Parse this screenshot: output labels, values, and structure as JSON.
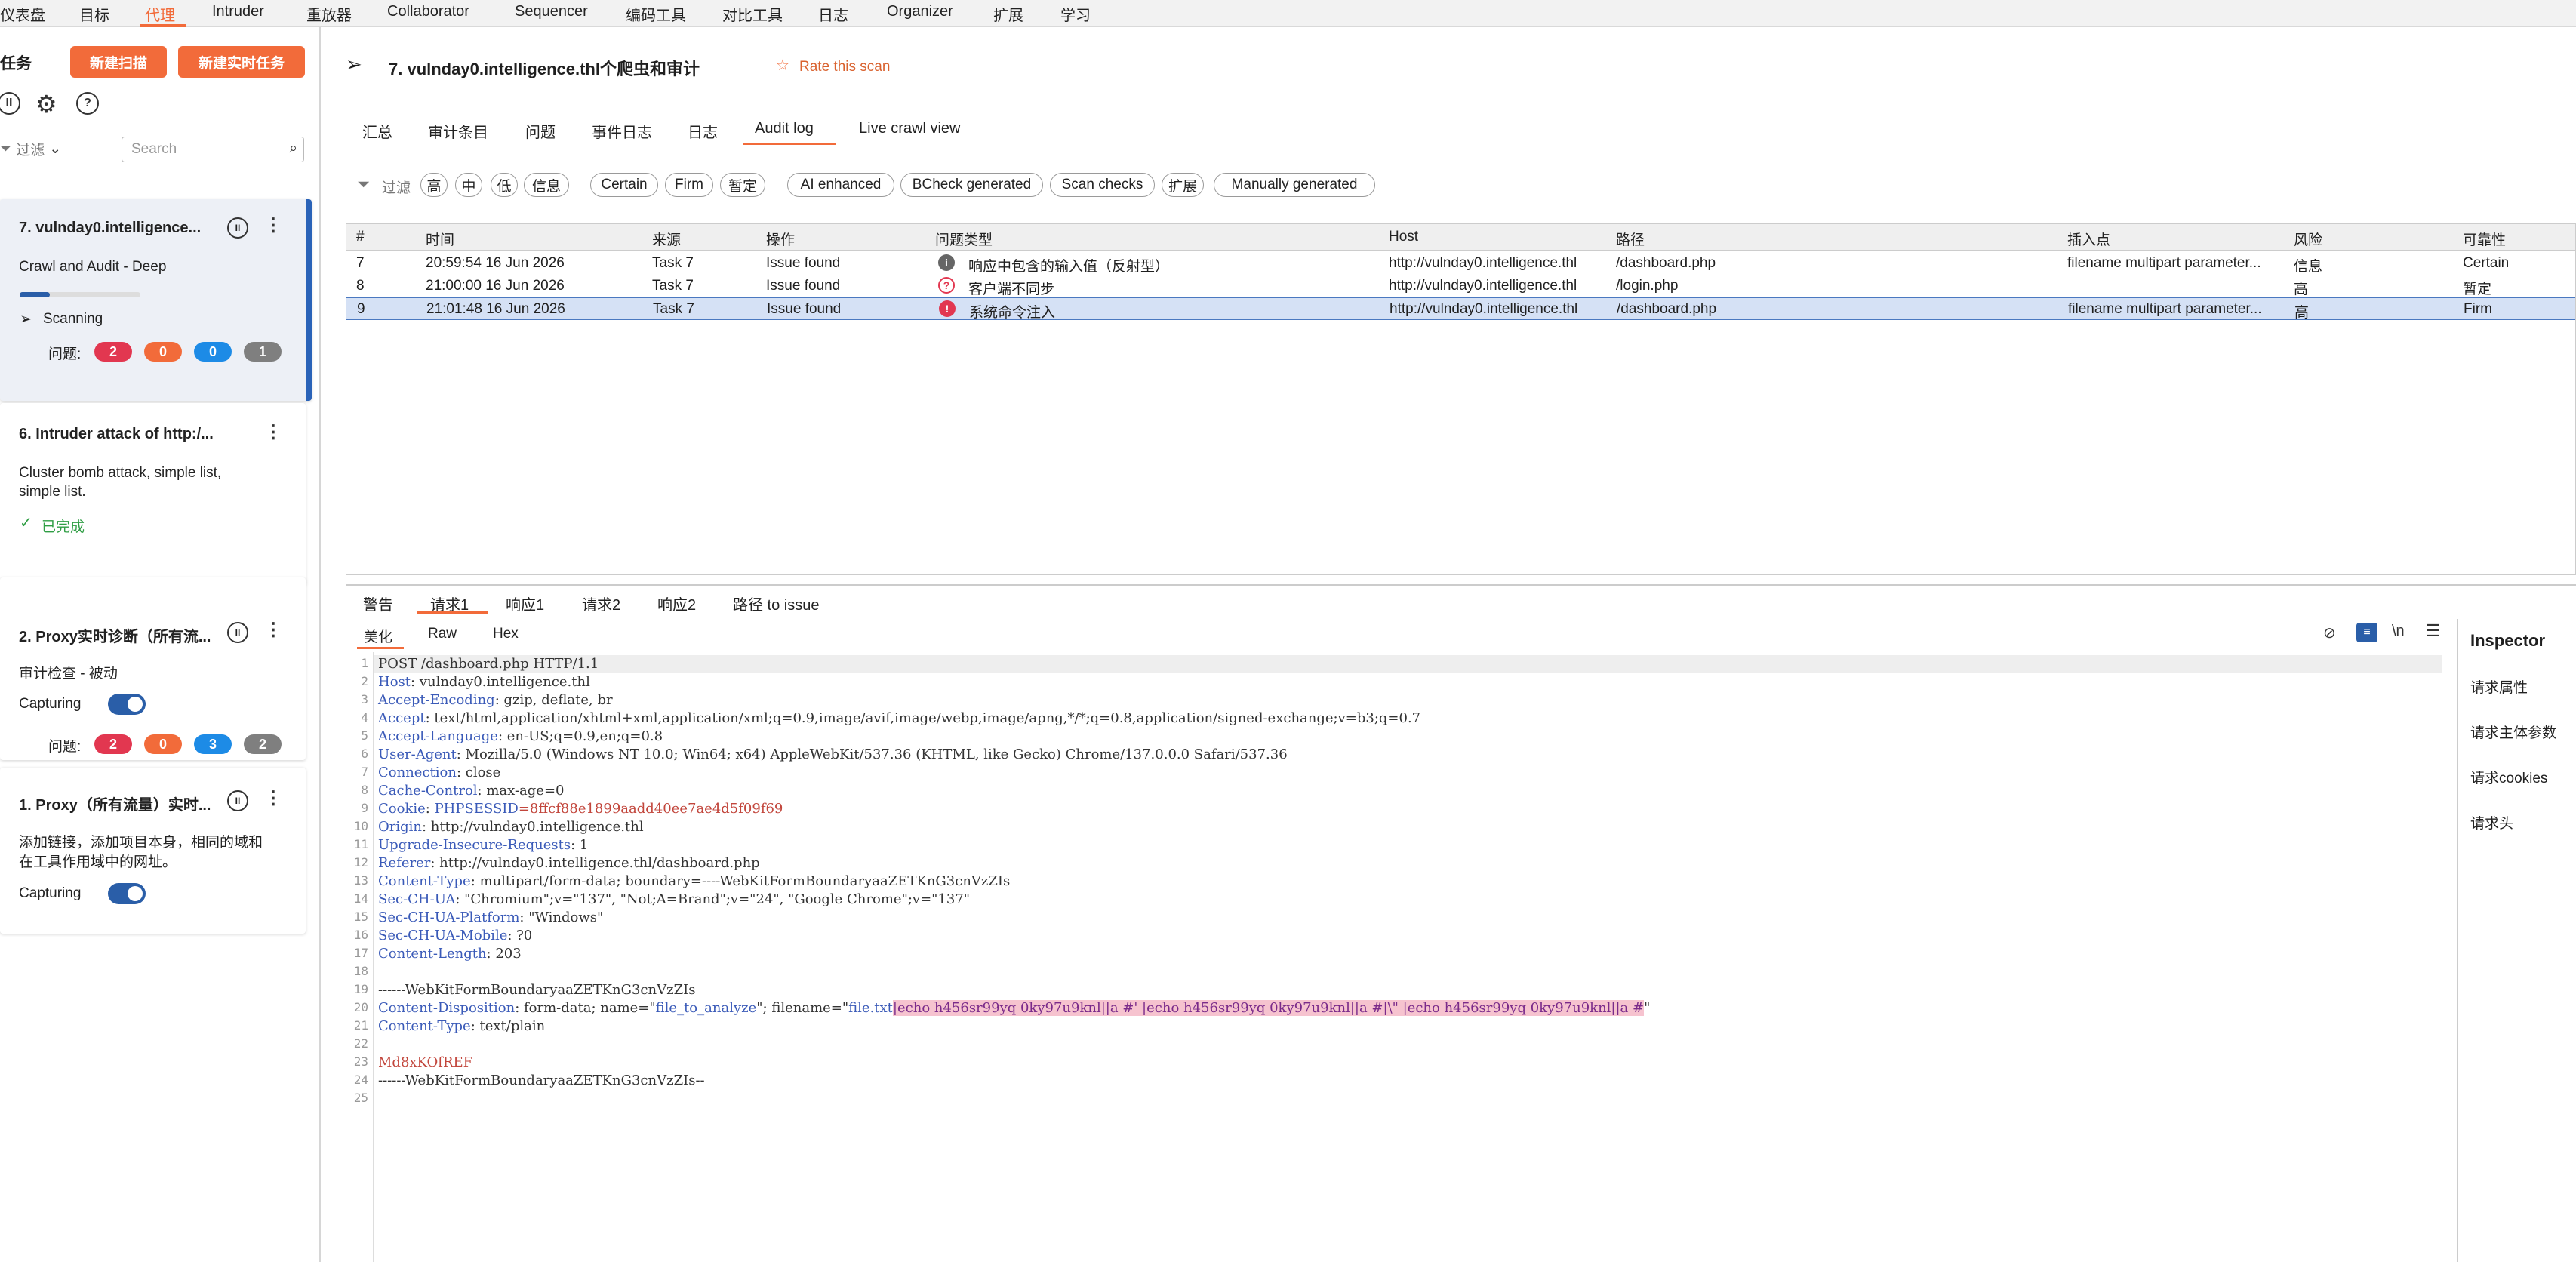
{
  "menu": [
    "仪表盘",
    "目标",
    "代理",
    "Intruder",
    "重放器",
    "Collaborator",
    "Sequencer",
    "编码工具",
    "对比工具",
    "日志",
    "Organizer",
    "扩展",
    "学习"
  ],
  "left": {
    "heading": "任务",
    "new_scan": "新建扫描",
    "new_live_task": "新建实时任务",
    "filter_label": "过滤",
    "search_placeholder": "Search",
    "tasks": [
      {
        "title": "7. vulnday0.intelligence...",
        "desc": "Crawl and Audit - Deep",
        "status": "Scanning",
        "issues_label": "问题:",
        "badges": [
          "2",
          "0",
          "0",
          "1"
        ],
        "progress": 0.25
      },
      {
        "title": "6. Intruder attack of http:/...",
        "desc": "Cluster bomb attack, simple list,",
        "desc2": "simple list.",
        "status": "已完成"
      },
      {
        "title": "2. Proxy实时诊断（所有流...",
        "desc": "审计检查 - 被动",
        "status": "Capturing",
        "issues_label": "问题:",
        "badges": [
          "2",
          "0",
          "3",
          "2"
        ]
      },
      {
        "title": "1. Proxy（所有流量）实时...",
        "desc": "添加链接，添加项目本身，相同的域和",
        "desc2": "在工具作用域中的网址。",
        "status": "Capturing"
      }
    ]
  },
  "main": {
    "title": "7. vulnday0.intelligence.thl个爬虫和审计",
    "rate": "Rate this scan",
    "tabs": [
      "汇总",
      "审计条目",
      "问题",
      "事件日志",
      "日志",
      "Audit log",
      "Live crawl view"
    ],
    "filter_label": "过滤",
    "chips": [
      "高",
      "中",
      "低",
      "信息",
      "Certain",
      "Firm",
      "暂定",
      "AI enhanced",
      "BCheck generated",
      "Scan checks",
      "扩展",
      "Manually generated"
    ],
    "columns": [
      "#",
      "时间",
      "来源",
      "操作",
      "问题类型",
      "Host",
      "路径",
      "插入点",
      "风险",
      "可靠性"
    ],
    "rows": [
      {
        "n": "7",
        "time": "20:59:54 16 Jun 2026",
        "src": "Task 7",
        "op": "Issue found",
        "type": "响应中包含的输入值（反射型）",
        "host": "http://vulnday0.intelligence.thl",
        "path": "/dashboard.php",
        "ins": "filename multipart parameter...",
        "risk": "信息",
        "rel": "Certain"
      },
      {
        "n": "8",
        "time": "21:00:00 16 Jun 2026",
        "src": "Task 7",
        "op": "Issue found",
        "type": "客户端不同步",
        "host": "http://vulnday0.intelligence.thl",
        "path": "/login.php",
        "ins": "",
        "risk": "高",
        "rel": "暂定"
      },
      {
        "n": "9",
        "time": "21:01:48 16 Jun 2026",
        "src": "Task 7",
        "op": "Issue found",
        "type": "系统命令注入",
        "host": "http://vulnday0.intelligence.thl",
        "path": "/dashboard.php",
        "ins": "filename multipart parameter...",
        "risk": "高",
        "rel": "Firm"
      }
    ],
    "lower_tabs": [
      "警告",
      "请求1",
      "响应1",
      "请求2",
      "响应2",
      "路径 to issue"
    ],
    "sub_tabs": [
      "美化",
      "Raw",
      "Hex"
    ],
    "wrap_label": "\\n",
    "code": {
      "l1": "POST /dashboard.php HTTP/1.1",
      "l2k": "Host",
      "l2v": ": vulnday0.intelligence.thl",
      "l3k": "Accept-Encoding",
      "l3v": ": gzip, deflate, br",
      "l4k": "Accept",
      "l4v": ": text/html,application/xhtml+xml,application/xml;q=0.9,image/avif,image/webp,image/apng,*/*;q=0.8,application/signed-exchange;v=b3;q=0.7",
      "l5k": "Accept-Language",
      "l5v": ": en-US;q=0.9,en;q=0.8",
      "l6k": "User-Agent",
      "l6v": ": Mozilla/5.0 (Windows NT 10.0; Win64; x64) AppleWebKit/537.36 (KHTML, like Gecko) Chrome/137.0.0.0 Safari/537.36",
      "l7k": "Connection",
      "l7v": ": close",
      "l8k": "Cache-Control",
      "l8v": ": max-age=0",
      "l9k": "Cookie",
      "l9a": ": ",
      "l9b": "PHPSESSID",
      "l9c": "=8ffcf88e1899aadd40ee7ae4d5f09f69",
      "l10k": "Origin",
      "l10v": ": http://vulnday0.intelligence.thl",
      "l11k": "Upgrade-Insecure-Requests",
      "l11v": ": 1",
      "l12k": "Referer",
      "l12v": ": http://vulnday0.intelligence.thl/dashboard.php",
      "l13k": "Content-Type",
      "l13v": ": multipart/form-data; boundary=----WebKitFormBoundaryaaZETKnG3cnVzZIs",
      "l14k": "Sec-CH-UA",
      "l14v": ": \"Chromium\";v=\"137\", \"Not;A=Brand\";v=\"24\", \"Google Chrome\";v=\"137\"",
      "l15k": "Sec-CH-UA-Platform",
      "l15v": ": \"Windows\"",
      "l16k": "Sec-CH-UA-Mobile",
      "l16v": ": ?0",
      "l17k": "Content-Length",
      "l17v": ": 203",
      "l19": "------WebKitFormBoundaryaaZETKnG3cnVzZIs",
      "l20k": "Content-Disposition",
      "l20a": ": form-data; name=\"",
      "l20b": "file_to_analyze",
      "l20c": "\"; filename=\"",
      "l20d": "file.txt",
      "l20e": "|echo h456sr99yq 0ky97u9knl||a #' |echo h456sr99yq 0ky97u9knl||a #|\\\" |echo h456sr99yq 0ky97u9knl||a #",
      "l20f": "\"",
      "l21k": "Content-Type",
      "l21v": ": text/plain",
      "l23": "Md8xKOfREF",
      "l24": "------WebKitFormBoundaryaaZETKnG3cnVzZIs--"
    },
    "inspector": {
      "title": "Inspector",
      "items": [
        "请求属性",
        "请求主体参数",
        "请求cookies",
        "请求头"
      ]
    }
  }
}
